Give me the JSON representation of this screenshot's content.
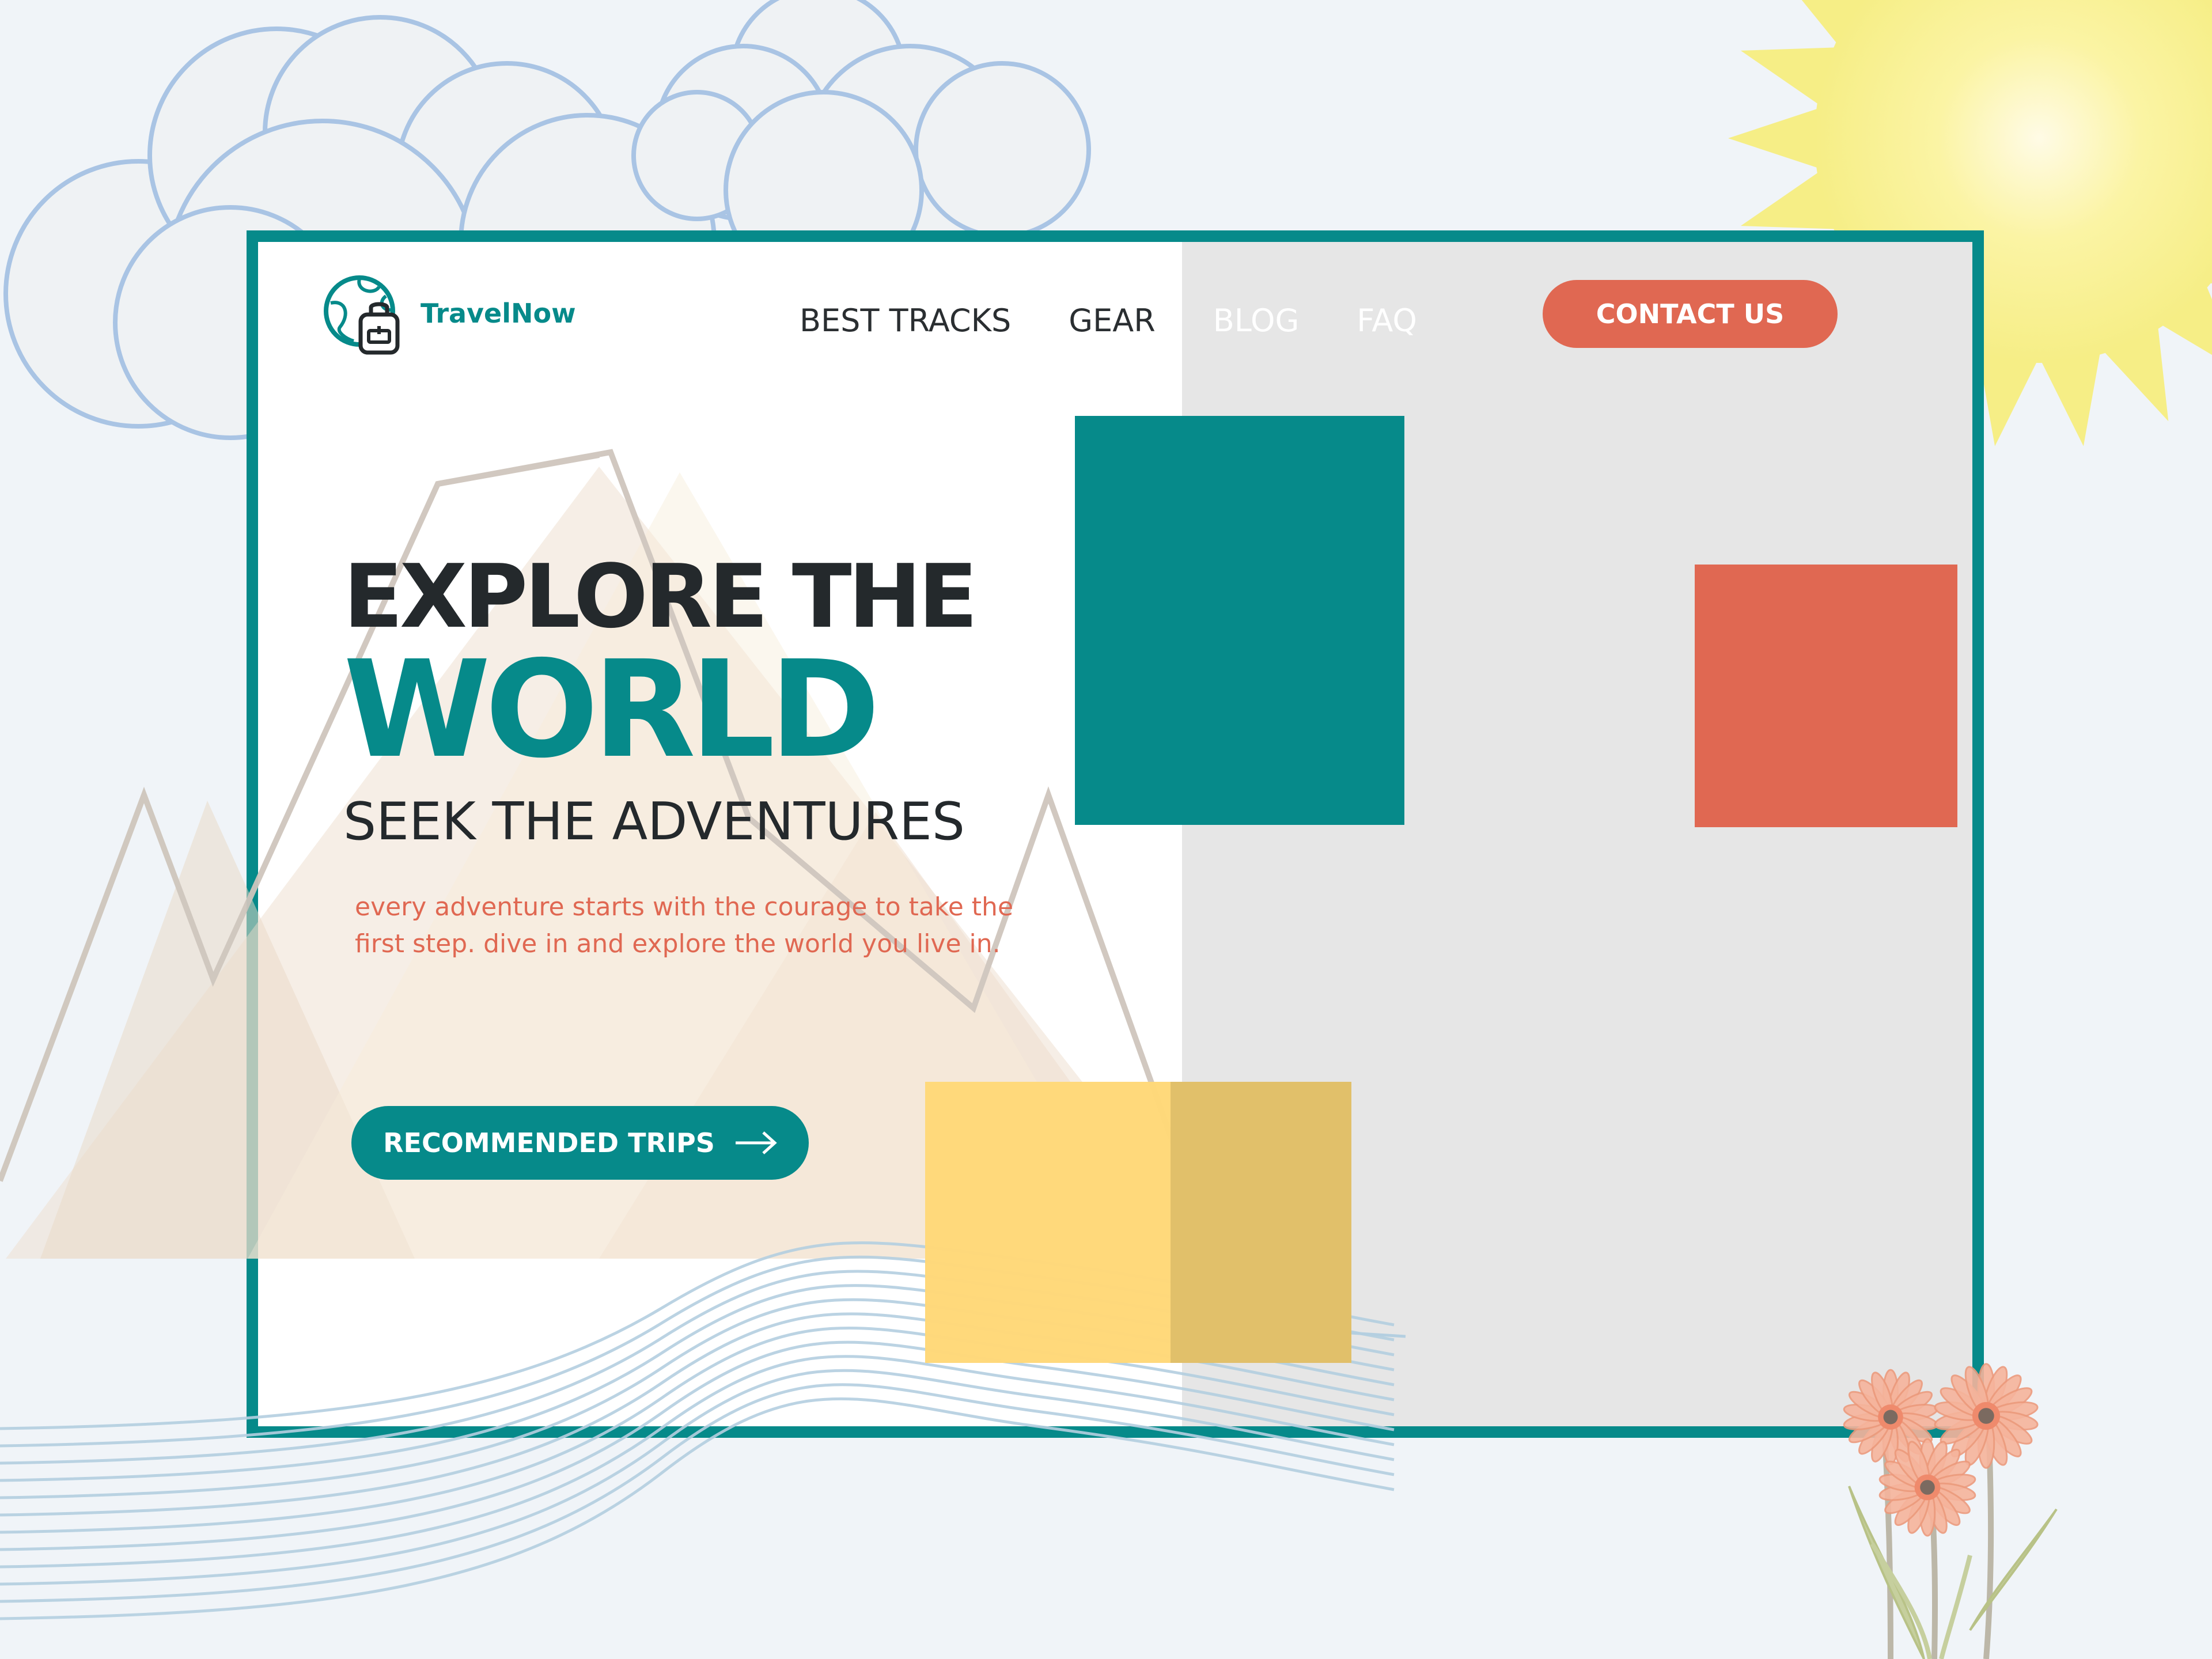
{
  "brand": {
    "name": "TravelNow"
  },
  "nav": {
    "items": [
      {
        "label": "BEST TRACKS"
      },
      {
        "label": "GEAR"
      },
      {
        "label": "BLOG"
      },
      {
        "label": "FAQ"
      }
    ]
  },
  "contact_button": {
    "label": "CONTACT US"
  },
  "hero": {
    "line1": "EXPLORE THE",
    "line2": "WORLD",
    "line3": "SEEK THE ADVENTURES",
    "tagline": "every adventure starts with the courage to take the first step. dive in and explore the world you live in."
  },
  "cta_button": {
    "label": "RECOMMENDED TRIPS",
    "icon": "arrow-right-icon"
  },
  "icons": {
    "logo": "globe-backpack-icon",
    "sun": "sun-icon",
    "clouds": "cloud-icon",
    "flowers": "flower-icon"
  },
  "colors": {
    "teal": "#068a8a",
    "coral": "#e06852",
    "yellow": "#ffd878",
    "dark": "#24292c",
    "panel_gray": "#e6e6e6",
    "background": "#f0f4f8"
  }
}
